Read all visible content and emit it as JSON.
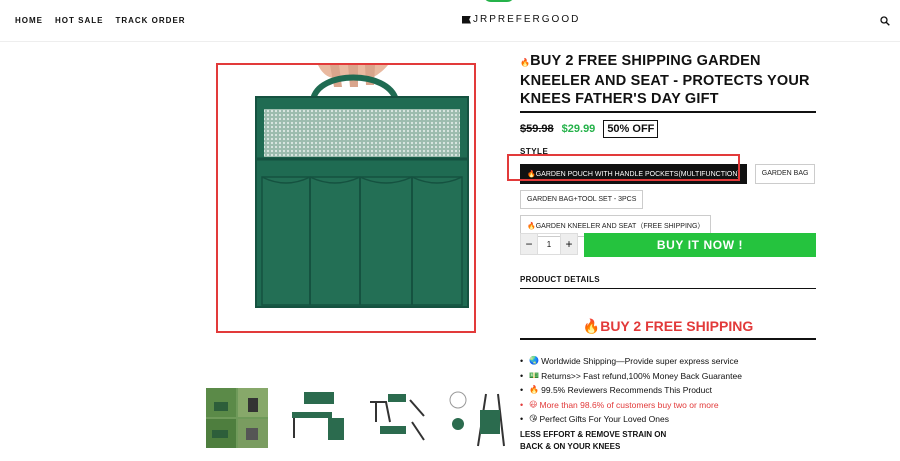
{
  "header": {
    "nav": [
      "HOME",
      "HOT SALE",
      "TRACK ORDER"
    ],
    "logo": "JRPREFERGOOD"
  },
  "product": {
    "title": "BUY 2 FREE SHIPPING GARDEN KNEELER AND SEAT - PROTECTS YOUR KNEES FATHER'S DAY GIFT",
    "title_icon": "fire-icon",
    "old_price": "$59.98",
    "new_price": "$29.99",
    "discount": "50% OFF",
    "style_label": "STYLE",
    "options": [
      {
        "label": "GARDEN POUCH WITH HANDLE POCKETS(MULTIFUNCTION)",
        "icon": "🔥",
        "selected": true
      },
      {
        "label": "GARDEN BAG",
        "icon": "",
        "selected": false
      },
      {
        "label": "GARDEN BAG+TOOL SET - 3PCS",
        "icon": "",
        "selected": false
      },
      {
        "label": "GARDEN KNEELER AND SEAT（FREE SHIPPING）",
        "icon": "🔥",
        "selected": false
      }
    ],
    "quantity": "1",
    "buy_label": "BUY IT NOW !",
    "details_label": "PRODUCT DETAILS"
  },
  "promo": {
    "title": "BUY 2 FREE SHIPPING",
    "bullets": [
      {
        "icon": "🌏",
        "text": "Worldwide Shipping—Provide super express service"
      },
      {
        "icon": "💵",
        "text": "Returns>> Fast refund,100% Money Back Guarantee"
      },
      {
        "icon": "🔥",
        "text": "99.5% Reviewers Recommends This Product"
      },
      {
        "icon": "😃",
        "text": "More than 98.6% of customers buy two or more"
      },
      {
        "icon": "😘",
        "text": "Perfect  Gifts For Your Loved Ones"
      }
    ],
    "effort_1": "LESS EFFORT & REMOVE STRAIN ON",
    "effort_2": "BACK & ON YOUR KNEES"
  },
  "colors": {
    "accent_green": "#25c33e",
    "price_green": "#25b24a",
    "highlight_red": "#e23a3a",
    "bag_green": "#1f6b52"
  }
}
